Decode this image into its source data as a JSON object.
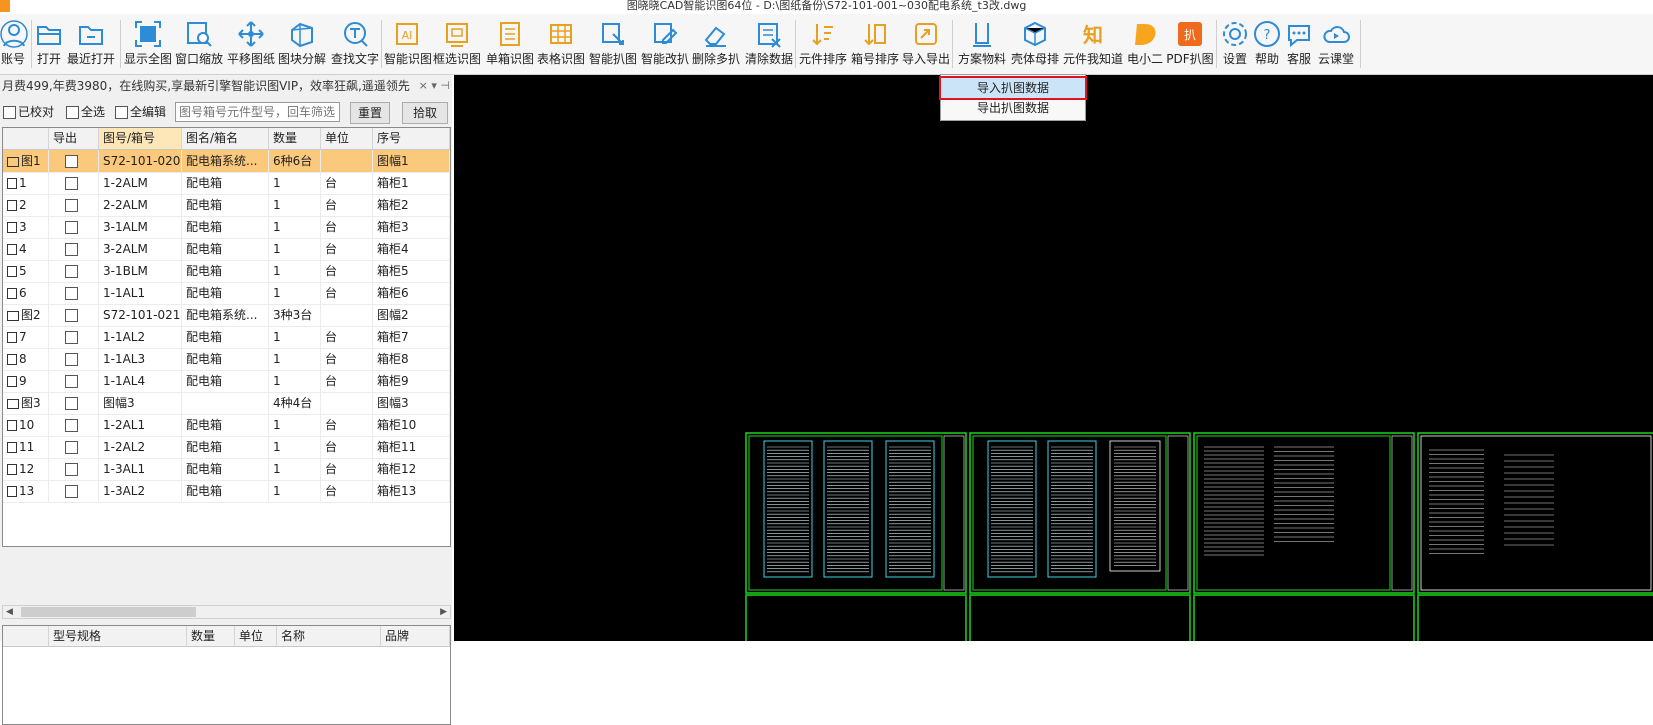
{
  "window": {
    "title": "图晓晓CAD智能识图64位 - D:\\图纸备份\\S72-101-001~030配电系统_t3改.dwg"
  },
  "toolbar": {
    "buttons": [
      {
        "label": "账号",
        "icon": "user-icon"
      },
      {
        "label": "打开",
        "icon": "folder-open-icon"
      },
      {
        "label": "最近打开",
        "icon": "recent-folder-icon"
      },
      {
        "label": "显示全图",
        "icon": "fit-view-icon"
      },
      {
        "label": "窗口缩放",
        "icon": "zoom-window-icon"
      },
      {
        "label": "平移图纸",
        "icon": "pan-icon"
      },
      {
        "label": "图块分解",
        "icon": "block-explode-icon"
      },
      {
        "label": "查找文字",
        "icon": "find-text-icon"
      },
      {
        "label": "智能识图",
        "icon": "ai-icon"
      },
      {
        "label": "框选识图",
        "icon": "box-select-icon"
      },
      {
        "label": "单箱识图",
        "icon": "single-box-icon"
      },
      {
        "label": "表格识图",
        "icon": "table-icon"
      },
      {
        "label": "智能扒图",
        "icon": "smart-capture-icon"
      },
      {
        "label": "智能改扒",
        "icon": "smart-edit-icon"
      },
      {
        "label": "删除多扒",
        "icon": "eraser-icon"
      },
      {
        "label": "清除数据",
        "icon": "clear-data-icon"
      },
      {
        "label": "元件排序",
        "icon": "sort-component-icon"
      },
      {
        "label": "箱号排序",
        "icon": "sort-box-icon"
      },
      {
        "label": "导入导出",
        "icon": "import-export-icon"
      },
      {
        "label": "方案物料",
        "icon": "material-icon"
      },
      {
        "label": "壳体母排",
        "icon": "cube-icon"
      },
      {
        "label": "元件我知道",
        "icon": "zhi-icon"
      },
      {
        "label": "电小二",
        "icon": "d-logo-icon"
      },
      {
        "label": "PDF扒图",
        "icon": "pdf-icon"
      },
      {
        "label": "设置",
        "icon": "gear-icon"
      },
      {
        "label": "帮助",
        "icon": "help-icon"
      },
      {
        "label": "客服",
        "icon": "chat-icon"
      },
      {
        "label": "云课堂",
        "icon": "cloud-play-icon"
      }
    ]
  },
  "dropdown": {
    "items": [
      {
        "label": "导入扒图数据",
        "highlighted": true
      },
      {
        "label": "导出扒图数据",
        "highlighted": false
      }
    ]
  },
  "promo": {
    "text": "月费499,年费3980，在线购买,享最新引擎智能识图VIP，效率狂飙,遥遥领先",
    "close": "×",
    "pin": "▾ ⊣"
  },
  "filter": {
    "verified_label": "已校对",
    "select_all_label": "全选",
    "all_edit_label": "全编辑",
    "search_placeholder": "图号箱号元件型号，回车筛选",
    "reset_label": "重置",
    "pick_label": "拾取"
  },
  "table": {
    "columns": [
      "导出",
      "图号/箱号",
      "图名/箱名",
      "数量",
      "单位",
      "序号"
    ],
    "rows": [
      {
        "idx": "图1",
        "type": "frame",
        "no": "S72-101-020",
        "name": "配电箱系统...",
        "qty": "6种6台",
        "unit": "",
        "seq": "图幅1",
        "selected": true
      },
      {
        "idx": "1",
        "type": "box",
        "no": "1-2ALM",
        "name": "配电箱",
        "qty": "1",
        "unit": "台",
        "seq": "箱柜1"
      },
      {
        "idx": "2",
        "type": "box",
        "no": "2-2ALM",
        "name": "配电箱",
        "qty": "1",
        "unit": "台",
        "seq": "箱柜2"
      },
      {
        "idx": "3",
        "type": "box",
        "no": "3-1ALM",
        "name": "配电箱",
        "qty": "1",
        "unit": "台",
        "seq": "箱柜3"
      },
      {
        "idx": "4",
        "type": "box",
        "no": "3-2ALM",
        "name": "配电箱",
        "qty": "1",
        "unit": "台",
        "seq": "箱柜4"
      },
      {
        "idx": "5",
        "type": "box",
        "no": "3-1BLM",
        "name": "配电箱",
        "qty": "1",
        "unit": "台",
        "seq": "箱柜5"
      },
      {
        "idx": "6",
        "type": "box",
        "no": "1-1AL1",
        "name": "配电箱",
        "qty": "1",
        "unit": "台",
        "seq": "箱柜6"
      },
      {
        "idx": "图2",
        "type": "frame",
        "no": "S72-101-021",
        "name": "配电箱系统...",
        "qty": "3种3台",
        "unit": "",
        "seq": "图幅2"
      },
      {
        "idx": "7",
        "type": "box",
        "no": "1-1AL2",
        "name": "配电箱",
        "qty": "1",
        "unit": "台",
        "seq": "箱柜7"
      },
      {
        "idx": "8",
        "type": "box",
        "no": "1-1AL3",
        "name": "配电箱",
        "qty": "1",
        "unit": "台",
        "seq": "箱柜8"
      },
      {
        "idx": "9",
        "type": "box",
        "no": "1-1AL4",
        "name": "配电箱",
        "qty": "1",
        "unit": "台",
        "seq": "箱柜9"
      },
      {
        "idx": "图3",
        "type": "frame",
        "no": "图幅3",
        "name": "",
        "qty": "4种4台",
        "unit": "",
        "seq": "图幅3"
      },
      {
        "idx": "10",
        "type": "box",
        "no": "1-2AL1",
        "name": "配电箱",
        "qty": "1",
        "unit": "台",
        "seq": "箱柜10"
      },
      {
        "idx": "11",
        "type": "box",
        "no": "1-2AL2",
        "name": "配电箱",
        "qty": "1",
        "unit": "台",
        "seq": "箱柜11"
      },
      {
        "idx": "12",
        "type": "box",
        "no": "1-3AL1",
        "name": "配电箱",
        "qty": "1",
        "unit": "台",
        "seq": "箱柜12"
      },
      {
        "idx": "13",
        "type": "box",
        "no": "1-3AL2",
        "name": "配电箱",
        "qty": "1",
        "unit": "台",
        "seq": "箱柜13"
      }
    ]
  },
  "subtable": {
    "columns": [
      "型号规格",
      "数量",
      "单位",
      "名称",
      "品牌"
    ]
  },
  "colors": {
    "canvas": "#000000",
    "cad_frame": "#1fd31f",
    "cad_inner": "#3bd6e6",
    "selected_row": "#fbc97b",
    "menu_highlight_border": "#e0141e"
  }
}
